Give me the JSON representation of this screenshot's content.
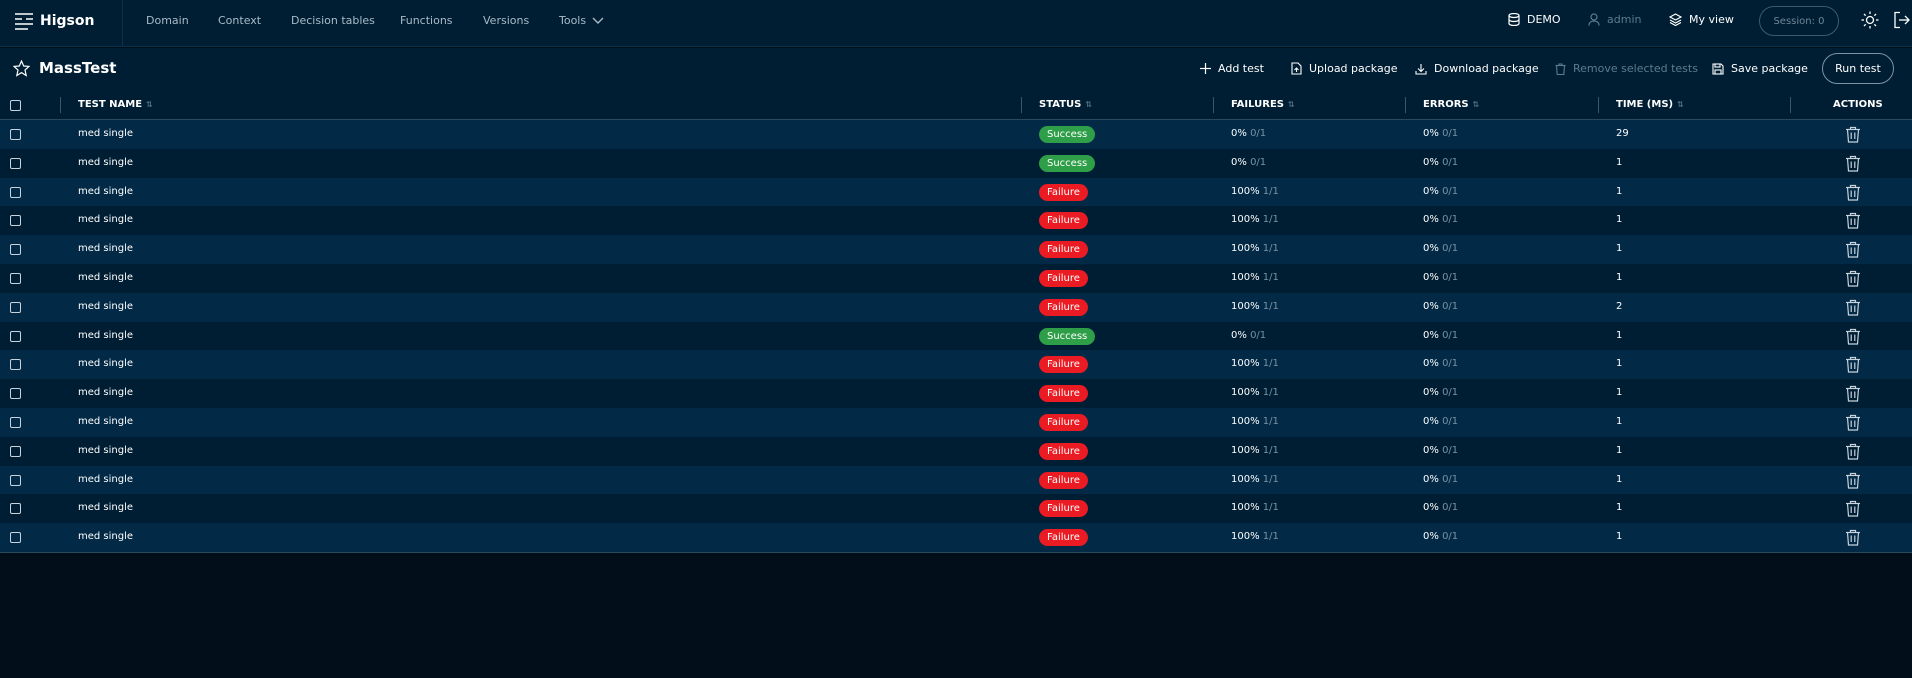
{
  "app": {
    "logo_text": "Higson",
    "nav": [
      "Domain",
      "Context",
      "Decision tables",
      "Functions",
      "Versions",
      "Tools"
    ],
    "env_label": "DEMO",
    "user_label": "admin",
    "view_label": "My view",
    "session_label": "Session: 0"
  },
  "page": {
    "title": "MassTest",
    "actions": {
      "add": "Add test",
      "upload": "Upload package",
      "download": "Download package",
      "remove": "Remove selected tests",
      "save": "Save package",
      "run": "Run test"
    }
  },
  "table": {
    "columns": {
      "name": "TEST NAME",
      "status": "STATUS",
      "failures": "FAILURES",
      "errors": "ERRORS",
      "time": "TIME (MS)",
      "actions": "ACTIONS"
    },
    "rows": [
      {
        "name": "med single",
        "status": "Success",
        "status_kind": "success",
        "fail_pct": "0%",
        "fail_ratio": "0/1",
        "err_pct": "0%",
        "err_ratio": "0/1",
        "time": "29"
      },
      {
        "name": "med single",
        "status": "Success",
        "status_kind": "success",
        "fail_pct": "0%",
        "fail_ratio": "0/1",
        "err_pct": "0%",
        "err_ratio": "0/1",
        "time": "1"
      },
      {
        "name": "med single",
        "status": "Failure",
        "status_kind": "failure",
        "fail_pct": "100%",
        "fail_ratio": "1/1",
        "err_pct": "0%",
        "err_ratio": "0/1",
        "time": "1"
      },
      {
        "name": "med single",
        "status": "Failure",
        "status_kind": "failure",
        "fail_pct": "100%",
        "fail_ratio": "1/1",
        "err_pct": "0%",
        "err_ratio": "0/1",
        "time": "1"
      },
      {
        "name": "med single",
        "status": "Failure",
        "status_kind": "failure",
        "fail_pct": "100%",
        "fail_ratio": "1/1",
        "err_pct": "0%",
        "err_ratio": "0/1",
        "time": "1"
      },
      {
        "name": "med single",
        "status": "Failure",
        "status_kind": "failure",
        "fail_pct": "100%",
        "fail_ratio": "1/1",
        "err_pct": "0%",
        "err_ratio": "0/1",
        "time": "1"
      },
      {
        "name": "med single",
        "status": "Failure",
        "status_kind": "failure",
        "fail_pct": "100%",
        "fail_ratio": "1/1",
        "err_pct": "0%",
        "err_ratio": "0/1",
        "time": "2"
      },
      {
        "name": "med single",
        "status": "Success",
        "status_kind": "success",
        "fail_pct": "0%",
        "fail_ratio": "0/1",
        "err_pct": "0%",
        "err_ratio": "0/1",
        "time": "1"
      },
      {
        "name": "med single",
        "status": "Failure",
        "status_kind": "failure",
        "fail_pct": "100%",
        "fail_ratio": "1/1",
        "err_pct": "0%",
        "err_ratio": "0/1",
        "time": "1"
      },
      {
        "name": "med single",
        "status": "Failure",
        "status_kind": "failure",
        "fail_pct": "100%",
        "fail_ratio": "1/1",
        "err_pct": "0%",
        "err_ratio": "0/1",
        "time": "1"
      },
      {
        "name": "med single",
        "status": "Failure",
        "status_kind": "failure",
        "fail_pct": "100%",
        "fail_ratio": "1/1",
        "err_pct": "0%",
        "err_ratio": "0/1",
        "time": "1"
      },
      {
        "name": "med single",
        "status": "Failure",
        "status_kind": "failure",
        "fail_pct": "100%",
        "fail_ratio": "1/1",
        "err_pct": "0%",
        "err_ratio": "0/1",
        "time": "1"
      },
      {
        "name": "med single",
        "status": "Failure",
        "status_kind": "failure",
        "fail_pct": "100%",
        "fail_ratio": "1/1",
        "err_pct": "0%",
        "err_ratio": "0/1",
        "time": "1"
      },
      {
        "name": "med single",
        "status": "Failure",
        "status_kind": "failure",
        "fail_pct": "100%",
        "fail_ratio": "1/1",
        "err_pct": "0%",
        "err_ratio": "0/1",
        "time": "1"
      },
      {
        "name": "med single",
        "status": "Failure",
        "status_kind": "failure",
        "fail_pct": "100%",
        "fail_ratio": "1/1",
        "err_pct": "0%",
        "err_ratio": "0/1",
        "time": "1"
      }
    ]
  },
  "icons": {
    "logo": "higson-logo-icon",
    "tools_dropdown": "chevron-down-icon",
    "env": "database-icon",
    "user": "user-icon",
    "view": "layers-icon",
    "theme": "sun-icon",
    "logout": "logout-icon",
    "favorite": "star-icon",
    "row_delete": "trash-icon"
  },
  "colors": {
    "background": "#020f1a",
    "panel": "#001e33",
    "row_alt": "#022a47",
    "success": "#2e9e48",
    "failure": "#ea1b22"
  }
}
